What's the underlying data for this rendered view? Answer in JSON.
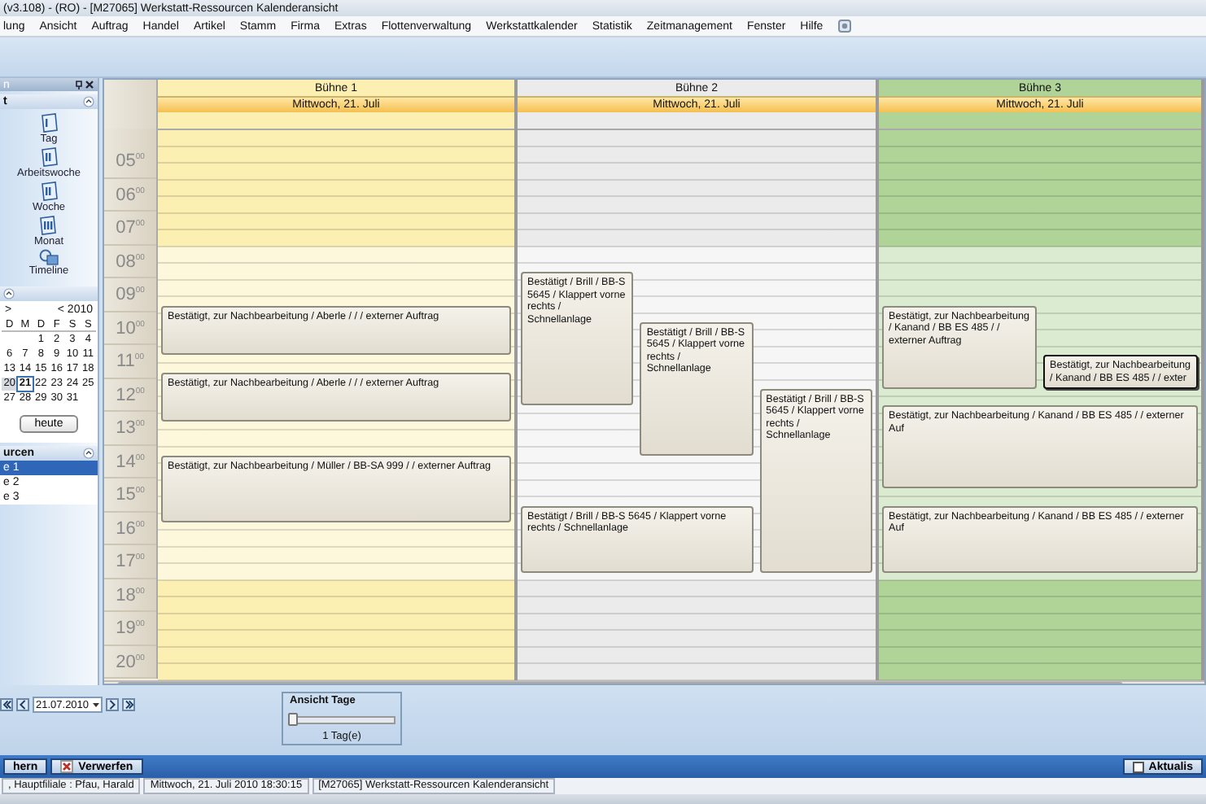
{
  "window": {
    "title": "(v3.108) - (RO) - [M27065] Werkstatt-Ressourcen Kalenderansicht"
  },
  "menu": [
    "lung",
    "Ansicht",
    "Auftrag",
    "Handel",
    "Artikel",
    "Stamm",
    "Firma",
    "Extras",
    "Flottenverwaltung",
    "Werkstattkalender",
    "Statistik",
    "Zeitmanagement",
    "Fenster",
    "Hilfe"
  ],
  "side_panel": {
    "title": "n",
    "views_section": {
      "title": "t",
      "items": [
        {
          "label": "Tag",
          "kind": "day"
        },
        {
          "label": "Arbeitswoche",
          "kind": "week"
        },
        {
          "label": "Woche",
          "kind": "week"
        },
        {
          "label": "Monat",
          "kind": "month"
        },
        {
          "label": "Timeline",
          "kind": "timeline"
        }
      ]
    },
    "calendar_section": {
      "next": ">",
      "prev": "<",
      "year": "2010",
      "weekdays": [
        "D",
        "M",
        "D",
        "F",
        "S",
        "S"
      ],
      "weeks": [
        [
          {
            "day": "1",
            "selected": false,
            "today": false
          },
          {
            "day": "2",
            "selected": false,
            "today": false
          },
          {
            "day": "3",
            "selected": false,
            "today": false
          },
          {
            "day": "4",
            "selected": false,
            "today": false
          }
        ],
        [
          {
            "day": "6",
            "selected": false,
            "today": false
          },
          {
            "day": "7",
            "selected": false,
            "today": false
          },
          {
            "day": "8",
            "selected": false,
            "today": false
          },
          {
            "day": "9",
            "selected": false,
            "today": false
          },
          {
            "day": "10",
            "selected": false,
            "today": false
          },
          {
            "day": "11",
            "selected": false,
            "today": false
          }
        ],
        [
          {
            "day": "13",
            "selected": false,
            "today": false
          },
          {
            "day": "14",
            "selected": false,
            "today": false
          },
          {
            "day": "15",
            "selected": false,
            "today": false
          },
          {
            "day": "16",
            "selected": false,
            "today": false
          },
          {
            "day": "17",
            "selected": false,
            "today": false
          },
          {
            "day": "18",
            "selected": false,
            "today": false
          }
        ],
        [
          {
            "day": "20",
            "selected": false,
            "today": true
          },
          {
            "day": "21",
            "selected": true,
            "today": false
          },
          {
            "day": "22",
            "selected": false,
            "today": false
          },
          {
            "day": "23",
            "selected": false,
            "today": false
          },
          {
            "day": "24",
            "selected": false,
            "today": false
          },
          {
            "day": "25",
            "selected": false,
            "today": false
          }
        ],
        [
          {
            "day": "27",
            "selected": false,
            "today": false
          },
          {
            "day": "28",
            "selected": false,
            "today": false
          },
          {
            "day": "29",
            "selected": false,
            "today": false
          },
          {
            "day": "30",
            "selected": false,
            "today": false
          },
          {
            "day": "31",
            "selected": false,
            "today": false
          }
        ]
      ],
      "today_button": "heute"
    },
    "resources_section": {
      "title": "urcen",
      "items": [
        {
          "label": "e 1",
          "selected": true
        },
        {
          "label": "e 2",
          "selected": false
        },
        {
          "label": "e 3",
          "selected": false
        }
      ]
    }
  },
  "calendar": {
    "hours": [
      "05$^{00}$",
      "06$^{00}$",
      "07$^{00}$",
      "08$^{00}$",
      "09$^{00}$",
      "10$^{00}$",
      "11$^{00}$",
      "12$^{00}$",
      "13$^{00}$",
      "14$^{00}$",
      "15$^{00}$",
      "16$^{00}$",
      "17$^{00}$",
      "18$^{00}$",
      "19$^{00}$",
      "20$^{00}$"
    ],
    "columns": [
      {
        "name": "Bühne 1",
        "date": "Mittwoch, 21. Juli",
        "color": "#fbefb2",
        "appointments": [
          {
            "text": "Bestätigt, zur Nachbearbeitung / Aberle /  /  / externer Auftrag",
            "selected": false
          },
          {
            "text": "Bestätigt, zur Nachbearbeitung / Aberle /  /  / externer Auftrag",
            "selected": false
          },
          {
            "text": "Bestätigt, zur Nachbearbeitung / Müller / BB-SA 999 /  / externer Auftrag",
            "selected": false
          }
        ]
      },
      {
        "name": "Bühne 2",
        "date": "Mittwoch, 21. Juli",
        "color": "#ebebeb",
        "appointments": [
          {
            "text": "Bestätigt / Brill / BB-S 5645 / Klappert vorne rechts / Schnellanlage",
            "selected": false
          },
          {
            "text": "Bestätigt / Brill / BB-S 5645 / Klappert vorne rechts / Schnellanlage",
            "selected": false
          },
          {
            "text": "Bestätigt / Brill / BB-S 5645 / Klappert vorne rechts / Schnellanlage",
            "selected": false
          },
          {
            "text": "Bestätigt / Brill / BB-S 5645 / Klappert vorne rechts / Schnellanlage",
            "selected": false
          }
        ]
      },
      {
        "name": "Bühne 3",
        "date": "Mittwoch, 21. Juli",
        "color": "#b0d398",
        "appointments": [
          {
            "text": "Bestätigt, zur Nachbearbeitung / Kanand / BB ES 485 /  / externer Auftrag",
            "selected": false
          },
          {
            "text": "Bestätigt, zur Nachbearbeitung / Kanand / BB ES 485 /  / exter",
            "selected": true
          },
          {
            "text": "Bestätigt, zur Nachbearbeitung / Kanand / BB ES 485 /  / externer Auf",
            "selected": false
          },
          {
            "text": "Bestätigt, zur Nachbearbeitung / Kanand / BB ES 485 /  / externer Auf",
            "selected": false
          }
        ]
      }
    ]
  },
  "date_navigator": {
    "date": "21.07.2010"
  },
  "view_days": {
    "title": "Ansicht Tage",
    "level": 0,
    "reading": "1 Tag(e)"
  },
  "action_bar": {
    "buttons": [
      {
        "label": "hern",
        "kind": "plain"
      },
      {
        "label": "Verwerfen",
        "kind": "discard"
      }
    ],
    "refresh": "Aktualis"
  },
  "status_bar": [
    ", Hauptfiliale : Pfau, Harald",
    "Mittwoch, 21. Juli 2010 18:30:15",
    "[M27065] Werkstatt-Ressourcen Kalenderansicht"
  ]
}
